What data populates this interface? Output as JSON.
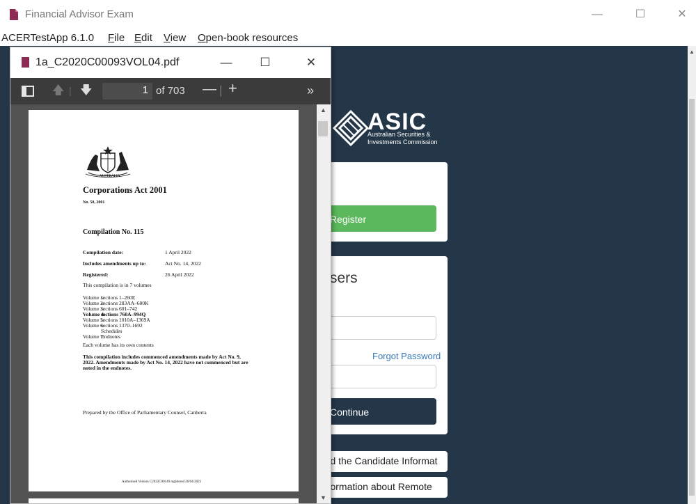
{
  "window": {
    "title": "Financial Advisor Exam"
  },
  "menu": {
    "app_name": "ACERTestApp 6.1.0",
    "file_prefix": "",
    "file_key": "F",
    "file_rest": "ile",
    "edit_key": "E",
    "edit_rest": "dit",
    "view_key": "V",
    "view_rest": "iew",
    "openbook_key": "O",
    "openbook_rest": "pen-book resources"
  },
  "pdf": {
    "filename": "1a_C2020C00093VOL04.pdf",
    "current_page": "1",
    "page_total": "of 703",
    "document": {
      "title": "Corporations Act 2001",
      "act_number": "No. 50, 2001",
      "compilation": "Compilation No. 115",
      "rows": [
        {
          "label": "Compilation date:",
          "value": "1 April 2022"
        },
        {
          "label": "Includes amendments up to:",
          "value": "Act No. 14, 2022"
        },
        {
          "label": "Registered:",
          "value": "26 April 2022"
        }
      ],
      "volumes_intro": "This compilation is in 7 volumes",
      "volumes": [
        {
          "vol": "Volume 1:",
          "sections": "sections 1–260E"
        },
        {
          "vol": "Volume 2:",
          "sections": "sections 283AA–600K"
        },
        {
          "vol": "Volume 3:",
          "sections": "sections 601–742"
        },
        {
          "vol": "Volume 4:",
          "sections": "sections 760A–994Q"
        },
        {
          "vol": "Volume 5:",
          "sections": "sections 1010A–1369A"
        },
        {
          "vol": "Volume 6:",
          "sections": "sections 1370–1692"
        },
        {
          "vol": "",
          "sections": "Schedules"
        },
        {
          "vol": "Volume 7:",
          "sections": "Endnotes"
        }
      ],
      "each_volume": "Each volume has its own contents",
      "note_line1": "This compilation includes commenced amendments made by Act No. 9,",
      "note_line2": "2022. Amendments made by Act No. 14, 2022 have not commenced but are",
      "note_line3": "noted in the endnotes.",
      "prepared_by": "Prepared by the Office of Parliamentary Counsel, Canberra",
      "footer": "Authorised Version C2022C00149 registered 26/04/2022",
      "crest_label": "AUSTRALIA"
    }
  },
  "site": {
    "brand": "ASIC",
    "brand_sub_line1": "Australian Securities &",
    "brand_sub_line2": "Investments Commission",
    "register_label": "Register",
    "users_heading": "sers",
    "forgot_password": "Forgot Password",
    "continue_label": "Continue",
    "download_link": "nload the Candidate Informat",
    "remote_link": "e information about Remote"
  }
}
